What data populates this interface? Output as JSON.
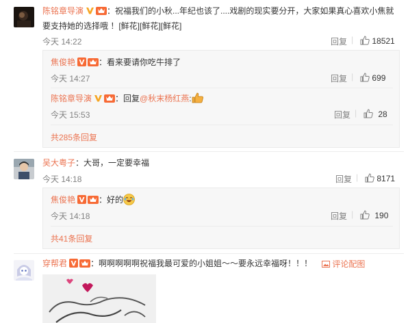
{
  "comments": [
    {
      "user": "陈铭章导演",
      "text_line1": "：祝福我们的小秋...年纪也该了....戏剧的现实要分开，大家如果真心喜欢小焦就",
      "text_line2": "要支持她的选择哦 ！[鲜花][鲜花][鲜花]",
      "time": "今天 14:22",
      "reply_label": "回复",
      "likes": "18521",
      "replies": [
        {
          "user": "焦俊艳",
          "text": "：看来要请你吃牛排了",
          "time": "今天 14:27",
          "reply_label": "回复",
          "likes": "699"
        },
        {
          "user": "陈铭章导演",
          "prefix": "：回复",
          "mention": "@秋末杨红燕",
          "suffix": ":",
          "time": "今天 15:53",
          "reply_label": "回复",
          "likes": "28"
        }
      ],
      "more": "共285条回复"
    },
    {
      "user": "吴大粤子",
      "text": "：大哥，一定要幸福",
      "time": "今天 14:18",
      "reply_label": "回复",
      "likes": "8171",
      "replies": [
        {
          "user": "焦俊艳",
          "text": "：好的",
          "time": "今天 14:18",
          "reply_label": "回复",
          "likes": "190"
        }
      ],
      "more": "共41条回复"
    },
    {
      "user": "穿帮君",
      "text": "：啊啊啊啊啊祝福我最可爱的小姐姐～～要永远幸福呀！！！",
      "report": "评论配图"
    }
  ]
}
